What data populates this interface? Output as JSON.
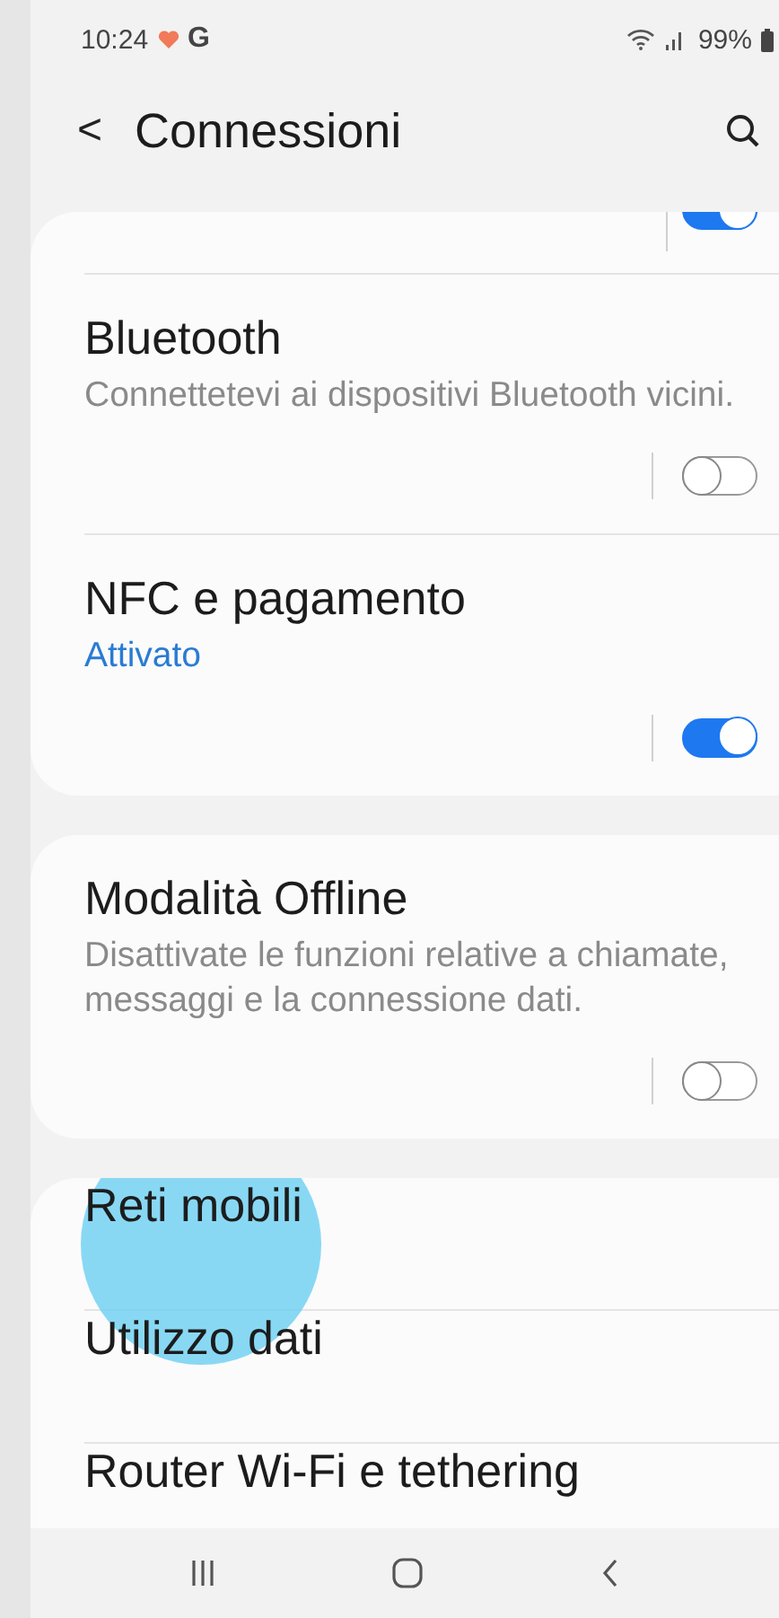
{
  "status_bar": {
    "time": "10:24",
    "carrier_letter": "G",
    "battery": "99%"
  },
  "header": {
    "back": "<",
    "title": "Connessioni"
  },
  "groups": [
    {
      "items": [
        {
          "kind": "cut",
          "on": true
        },
        {
          "kind": "toggle",
          "title": "Bluetooth",
          "subtitle": "Connettetevi ai dispositivi Bluetooth vicini.",
          "subtitle_accent": false,
          "on": false
        },
        {
          "kind": "toggle",
          "title": "NFC e pagamento",
          "subtitle": "Attivato",
          "subtitle_accent": true,
          "on": true
        }
      ]
    },
    {
      "items": [
        {
          "kind": "toggle",
          "title": "Modalità Offline",
          "subtitle": "Disattivate le funzioni relative a chiamate, messaggi e la connessione dati.",
          "subtitle_accent": false,
          "on": false
        }
      ]
    },
    {
      "items": [
        {
          "kind": "link",
          "title": "Reti mobili",
          "touched": true
        },
        {
          "kind": "link",
          "title": "Utilizzo dati",
          "touched": false
        },
        {
          "kind": "link",
          "title": "Router Wi-Fi e tethering",
          "touched": false
        }
      ]
    }
  ]
}
